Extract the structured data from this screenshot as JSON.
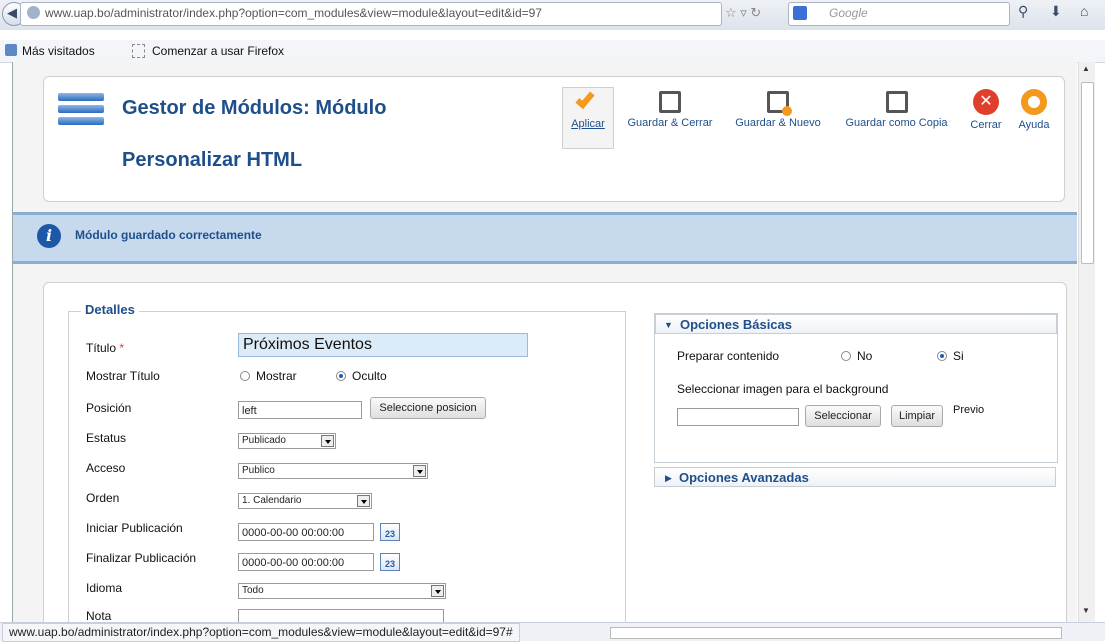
{
  "browser": {
    "url": "www.uap.bo/administrator/index.php?option=com_modules&view=module&layout=edit&id=97",
    "search_engine": "Google",
    "bookmarks": [
      "Más visitados",
      "Comenzar a usar Firefox"
    ],
    "status_url": "www.uap.bo/administrator/index.php?option=com_modules&view=module&layout=edit&id=97#"
  },
  "header": {
    "title_line1": "Gestor de Módulos: Módulo",
    "title_line2": "Personalizar HTML"
  },
  "toolbar": {
    "apply": "Aplicar",
    "save_close": "Guardar & Cerrar",
    "save_new": "Guardar & Nuevo",
    "save_copy": "Guardar como Copia",
    "close": "Cerrar",
    "help": "Ayuda"
  },
  "message": "Módulo guardado correctamente",
  "details": {
    "legend": "Detalles",
    "title_label": "Título",
    "required_mark": "*",
    "title_value": "Próximos Eventos",
    "show_title_label": "Mostrar Título",
    "show_title_options": [
      "Mostrar",
      "Oculto"
    ],
    "position_label": "Posición",
    "position_value": "left",
    "select_position_button": "Seleccione posicion",
    "status_label": "Estatus",
    "status_value": "Publicado",
    "access_label": "Acceso",
    "access_value": "Publico",
    "order_label": "Orden",
    "order_value": "1. Calendario",
    "start_pub_label": "Iniciar Publicación",
    "start_pub_value": "0000-00-00 00:00:00",
    "end_pub_label": "Finalizar Publicación",
    "end_pub_value": "0000-00-00 00:00:00",
    "calendar_day": "23",
    "language_label": "Idioma",
    "language_value": "Todo",
    "note_label": "Nota"
  },
  "basic_options": {
    "heading": "Opciones Básicas",
    "prepare_label": "Preparar contenido",
    "prepare_options": [
      "No",
      "Si"
    ],
    "bg_image_label": "Seleccionar imagen para el background",
    "select_button": "Seleccionar",
    "clear_button": "Limpiar",
    "preview_label": "Previo"
  },
  "advanced_options": {
    "heading": "Opciones Avanzadas"
  }
}
